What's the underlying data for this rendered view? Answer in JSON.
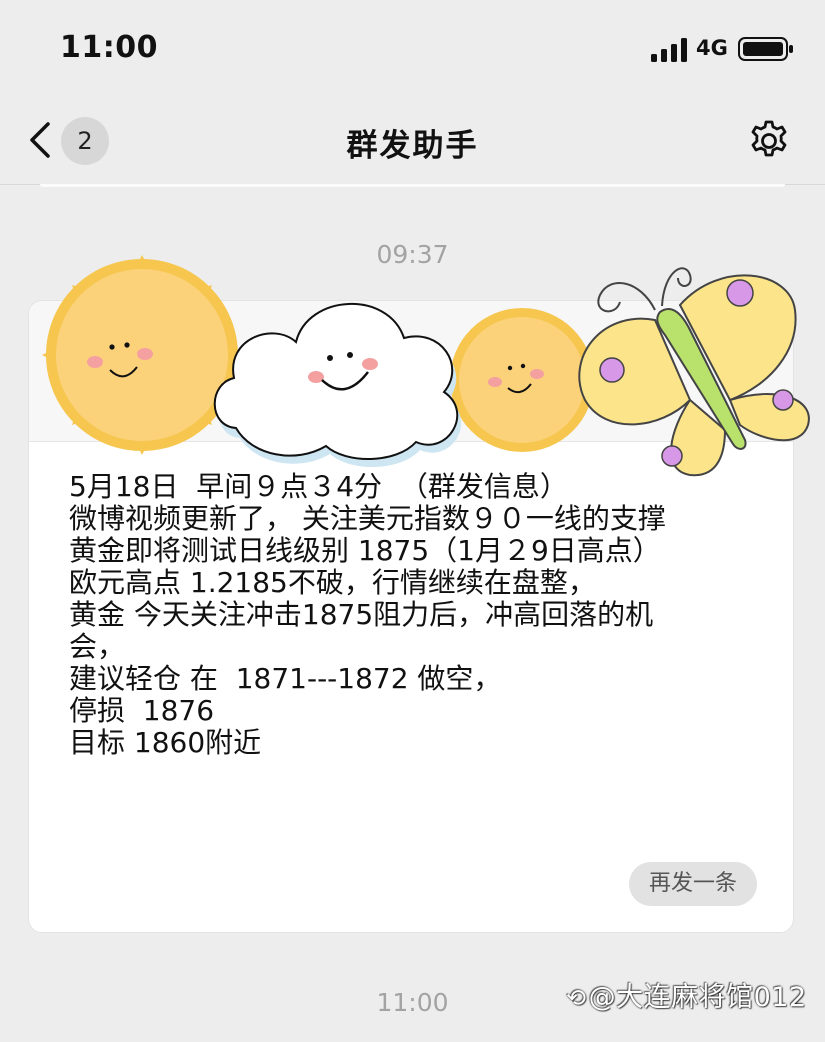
{
  "status_bar": {
    "time": "11:00",
    "network": "4G"
  },
  "nav": {
    "back_count": "2",
    "title": "群发助手"
  },
  "timestamps": {
    "first": "09:37",
    "second": "11:00"
  },
  "message": {
    "lines": [
      "5月18日  早间９点３4分  （群发信息）",
      "微博视频更新了， 关注美元指数９０一线的支撑",
      "黄金即将测试日线级别 1875（1月２9日高点）",
      "欧元高点 1.2185不破，行情继续在盘整，",
      "黄金 今天关注冲击1875阻力后，冲高回落的机",
      "会，",
      "建议轻仓 在  1871---1872 做空，",
      "停损  1876",
      "目标 1860附近"
    ],
    "resend_label": "再发一条"
  },
  "watermark": {
    "logo": "⟲",
    "text": "@大连麻将馆012"
  },
  "colors": {
    "background": "#ededed",
    "card": "#ffffff",
    "sun": "#fbd27a",
    "sun_rays": "#f6c64f",
    "cloud": "#ffffff",
    "butterfly_wing": "#fbe48a",
    "butterfly_body": "#b8e26c",
    "butterfly_spots": "#d898e8"
  },
  "icons": {
    "back": "chevron-left-icon",
    "settings": "gear-icon",
    "signal": "cellular-signal-icon",
    "battery": "battery-icon"
  }
}
